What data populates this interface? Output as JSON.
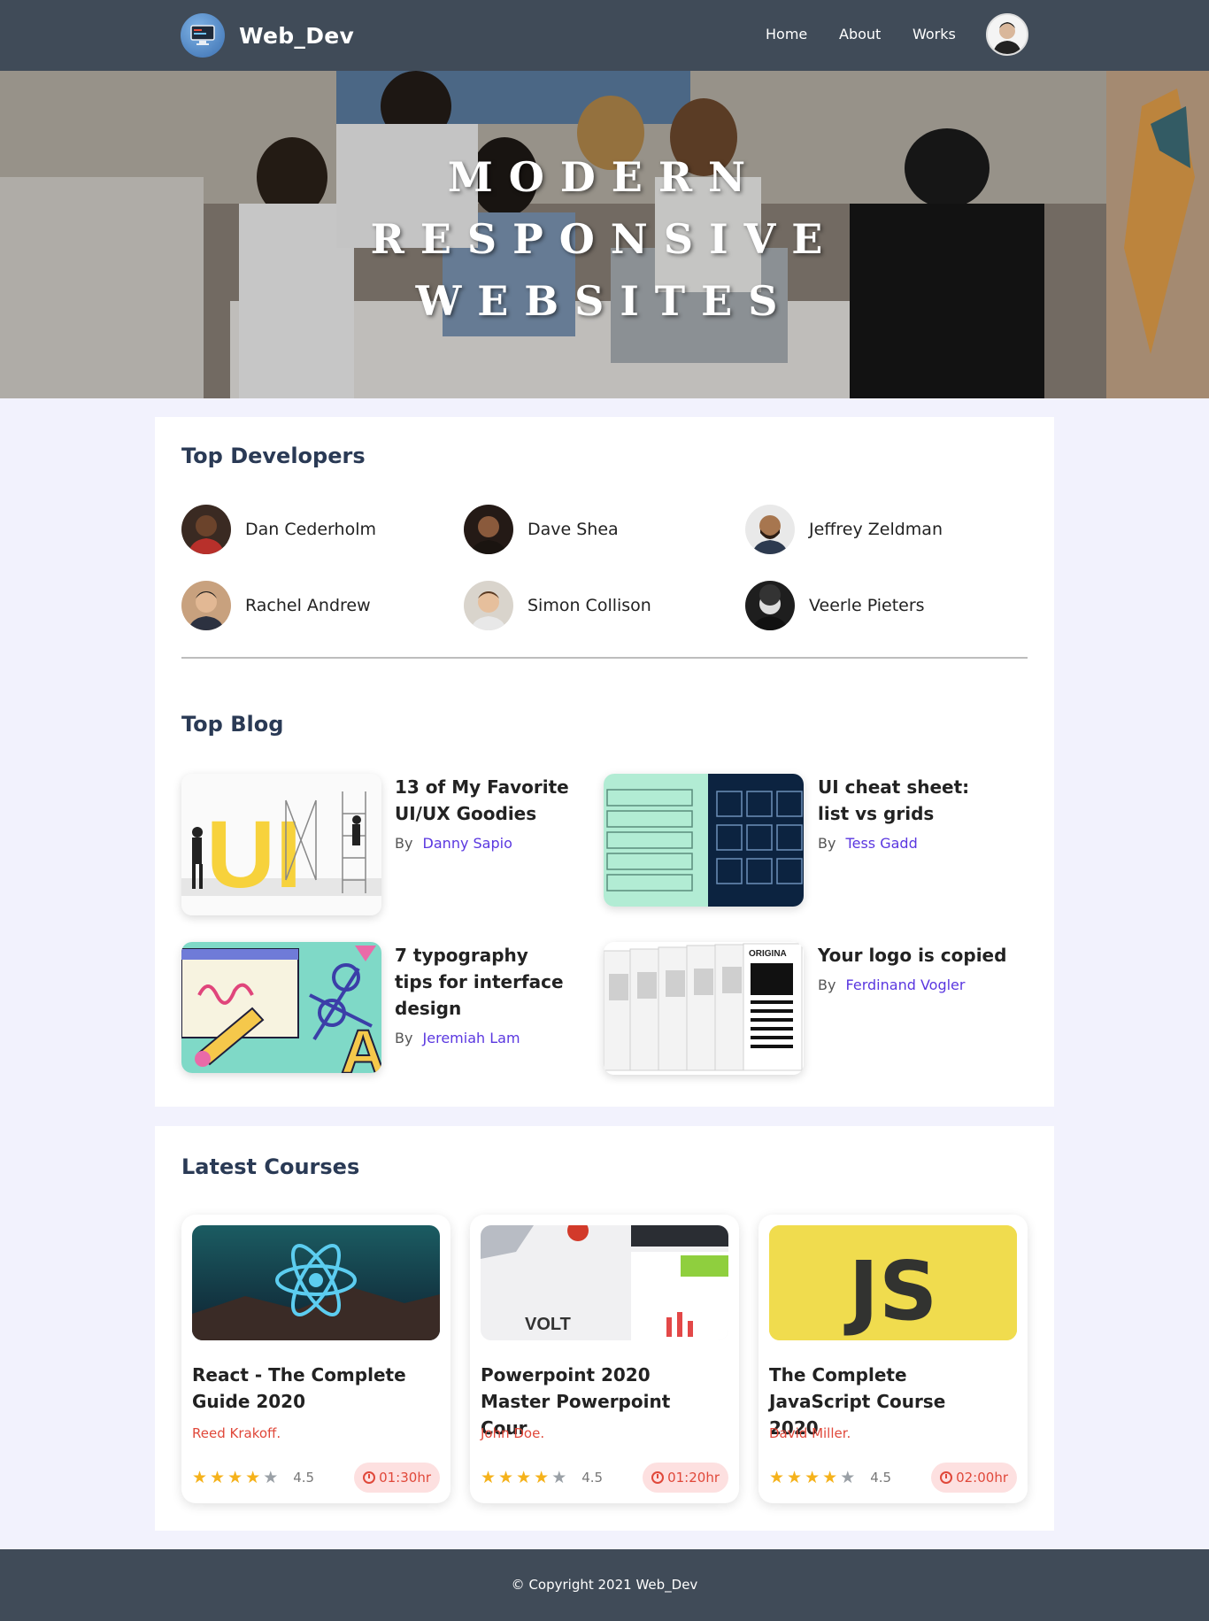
{
  "navbar": {
    "brand": "Web_Dev",
    "links": [
      "Home",
      "About",
      "Works"
    ]
  },
  "hero": {
    "lines": [
      "MODERN",
      "RESPONSIVE",
      "WEBSITES"
    ]
  },
  "developers": {
    "title": "Top Developers",
    "items": [
      {
        "name": "Dan Cederholm"
      },
      {
        "name": "Dave Shea"
      },
      {
        "name": "Jeffrey Zeldman"
      },
      {
        "name": "Rachel Andrew"
      },
      {
        "name": "Simon Collison"
      },
      {
        "name": "Veerle Pieters"
      }
    ]
  },
  "blog": {
    "title": "Top Blog",
    "by_label": "By",
    "posts": [
      {
        "title": "13 of My Favorite UI/UX Goodies",
        "author": "Danny Sapio"
      },
      {
        "title": "UI cheat sheet: list vs grids",
        "author": "Tess Gadd"
      },
      {
        "title": "7 typography tips for interface design",
        "author": "Jeremiah Lam"
      },
      {
        "title": "Your logo is copied",
        "author": "Ferdinand Vogler"
      }
    ],
    "thumb_text": {
      "ui": "UI",
      "orig": "ORIGINA",
      "letter": "A"
    }
  },
  "courses": {
    "title": "Latest Courses",
    "items": [
      {
        "title": "React - The Complete Guide 2020",
        "author": "Reed Krakoff.",
        "rating": "4.5",
        "stars": 4,
        "duration": "01:30hr"
      },
      {
        "title": "Powerpoint 2020 Master Powerpoint Cour",
        "author": "John Doe.",
        "rating": "4.5",
        "stars": 4,
        "duration": "01:20hr",
        "image_text": "VOLT"
      },
      {
        "title": "The Complete JavaScript Course 2020",
        "author": "David Miller.",
        "rating": "4.5",
        "stars": 4,
        "duration": "02:00hr",
        "image_text": "JS"
      }
    ]
  },
  "footer": {
    "text": "© Copyright 2021 Web_Dev"
  },
  "colors": {
    "navbar": "#404b58",
    "page_bg": "#f2f2fd",
    "accent_link": "#5a37e0",
    "course_author": "#e0483a",
    "star": "#f5b21b",
    "duration_bg": "#fde0e0"
  },
  "icons": [
    "computer-monitor-icon",
    "user-avatar-icon",
    "star-icon",
    "clock-icon"
  ]
}
